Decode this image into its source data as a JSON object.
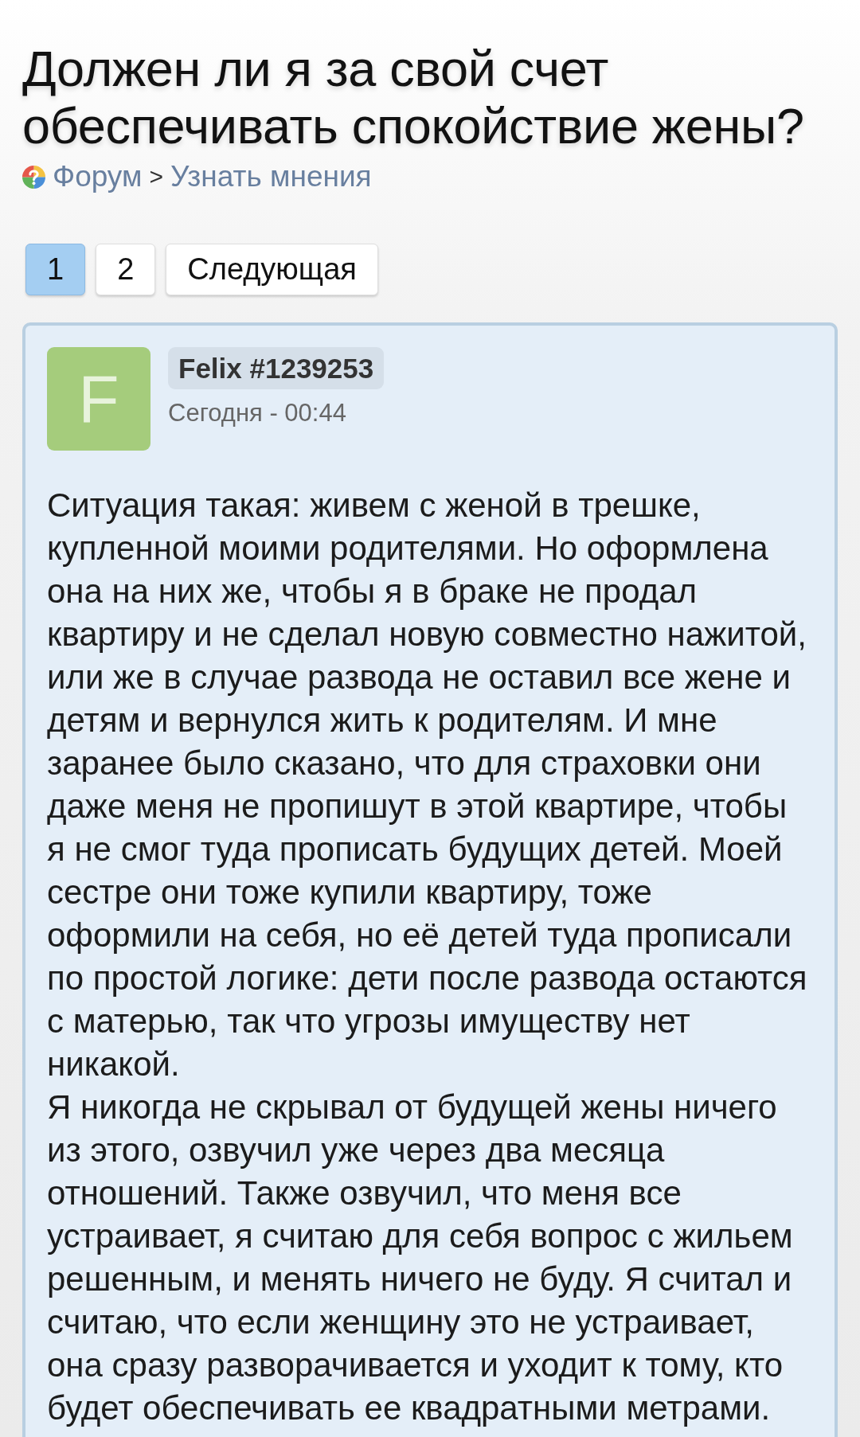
{
  "title": "Должен ли я за свой счет обеспечивать спокойствие жены?",
  "breadcrumb": {
    "items": [
      {
        "label": "Форум"
      },
      {
        "label": "Узнать мнения"
      }
    ],
    "separator": ">"
  },
  "pagination": [
    {
      "label": "1",
      "selected": true
    },
    {
      "label": "2",
      "selected": false
    },
    {
      "label": "Следующая",
      "selected": false
    }
  ],
  "post": {
    "avatar_letter": "F",
    "author": "Felix #1239253",
    "time": "Сегодня - 00:44",
    "paragraphs": [
      "Ситуация такая: живем с женой в трешке, купленной моими родителями. Но оформлена она на них же, чтобы я в браке не продал квартиру и не сделал новую совместно нажитой, или же в случае развода не оставил все жене и детям и вернулся жить к родителям. И мне заранее было сказано, что для страховки они даже меня не пропишут в этой квартире, чтобы я не смог туда прописать будущих детей. Моей сестре они тоже купили квартиру, тоже оформили на себя, но её детей туда прописали по простой логике: дети после развода остаются с матерью, так что угрозы имуществу нет никакой.",
      "Я никогда не скрывал от будущей жены ничего из этого, озвучил уже через два месяца отношений. Также озвучил, что меня все устраивает, я считаю для себя вопрос с жильем решенным, и менять ничего не буду. Я считал и считаю, что если женщину это не устраивает, она сразу разворачивается и уходит к тому, кто будет обеспечивать ее квадратными метрами."
    ]
  }
}
